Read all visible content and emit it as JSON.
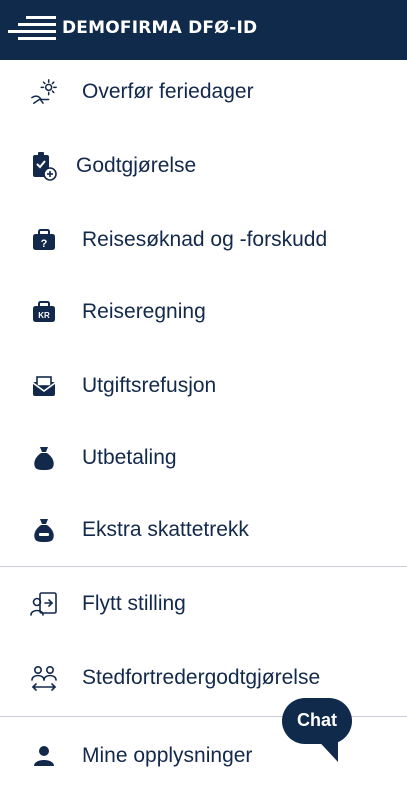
{
  "header": {
    "brand": "DEMOFIRMA DFØ-ID",
    "bg_color": "#0f2a4a"
  },
  "menu": {
    "items": [
      {
        "label": "Overfør feriedager",
        "icon": "beach-chair-sun-icon"
      },
      {
        "label": "Godtgjørelse",
        "icon": "clipboard-check-plus-icon"
      },
      {
        "label": "Reisesøknad og -forskudd",
        "icon": "suitcase-question-icon"
      },
      {
        "label": "Reiseregning",
        "icon": "suitcase-kr-icon"
      },
      {
        "label": "Utgiftsrefusjon",
        "icon": "envelope-money-icon"
      },
      {
        "label": "Utbetaling",
        "icon": "money-bag-icon"
      },
      {
        "label": "Ekstra skattetrekk",
        "icon": "money-bag-minus-icon"
      },
      {
        "label": "Flytt stilling",
        "icon": "person-move-icon"
      },
      {
        "label": "Stedfortredergodtgjørelse",
        "icon": "people-swap-icon"
      },
      {
        "label": "Mine opplysninger",
        "icon": "person-icon"
      }
    ]
  },
  "chat": {
    "label": "Chat"
  },
  "colors": {
    "text": "#13294b",
    "divider": "#c9ced6"
  }
}
